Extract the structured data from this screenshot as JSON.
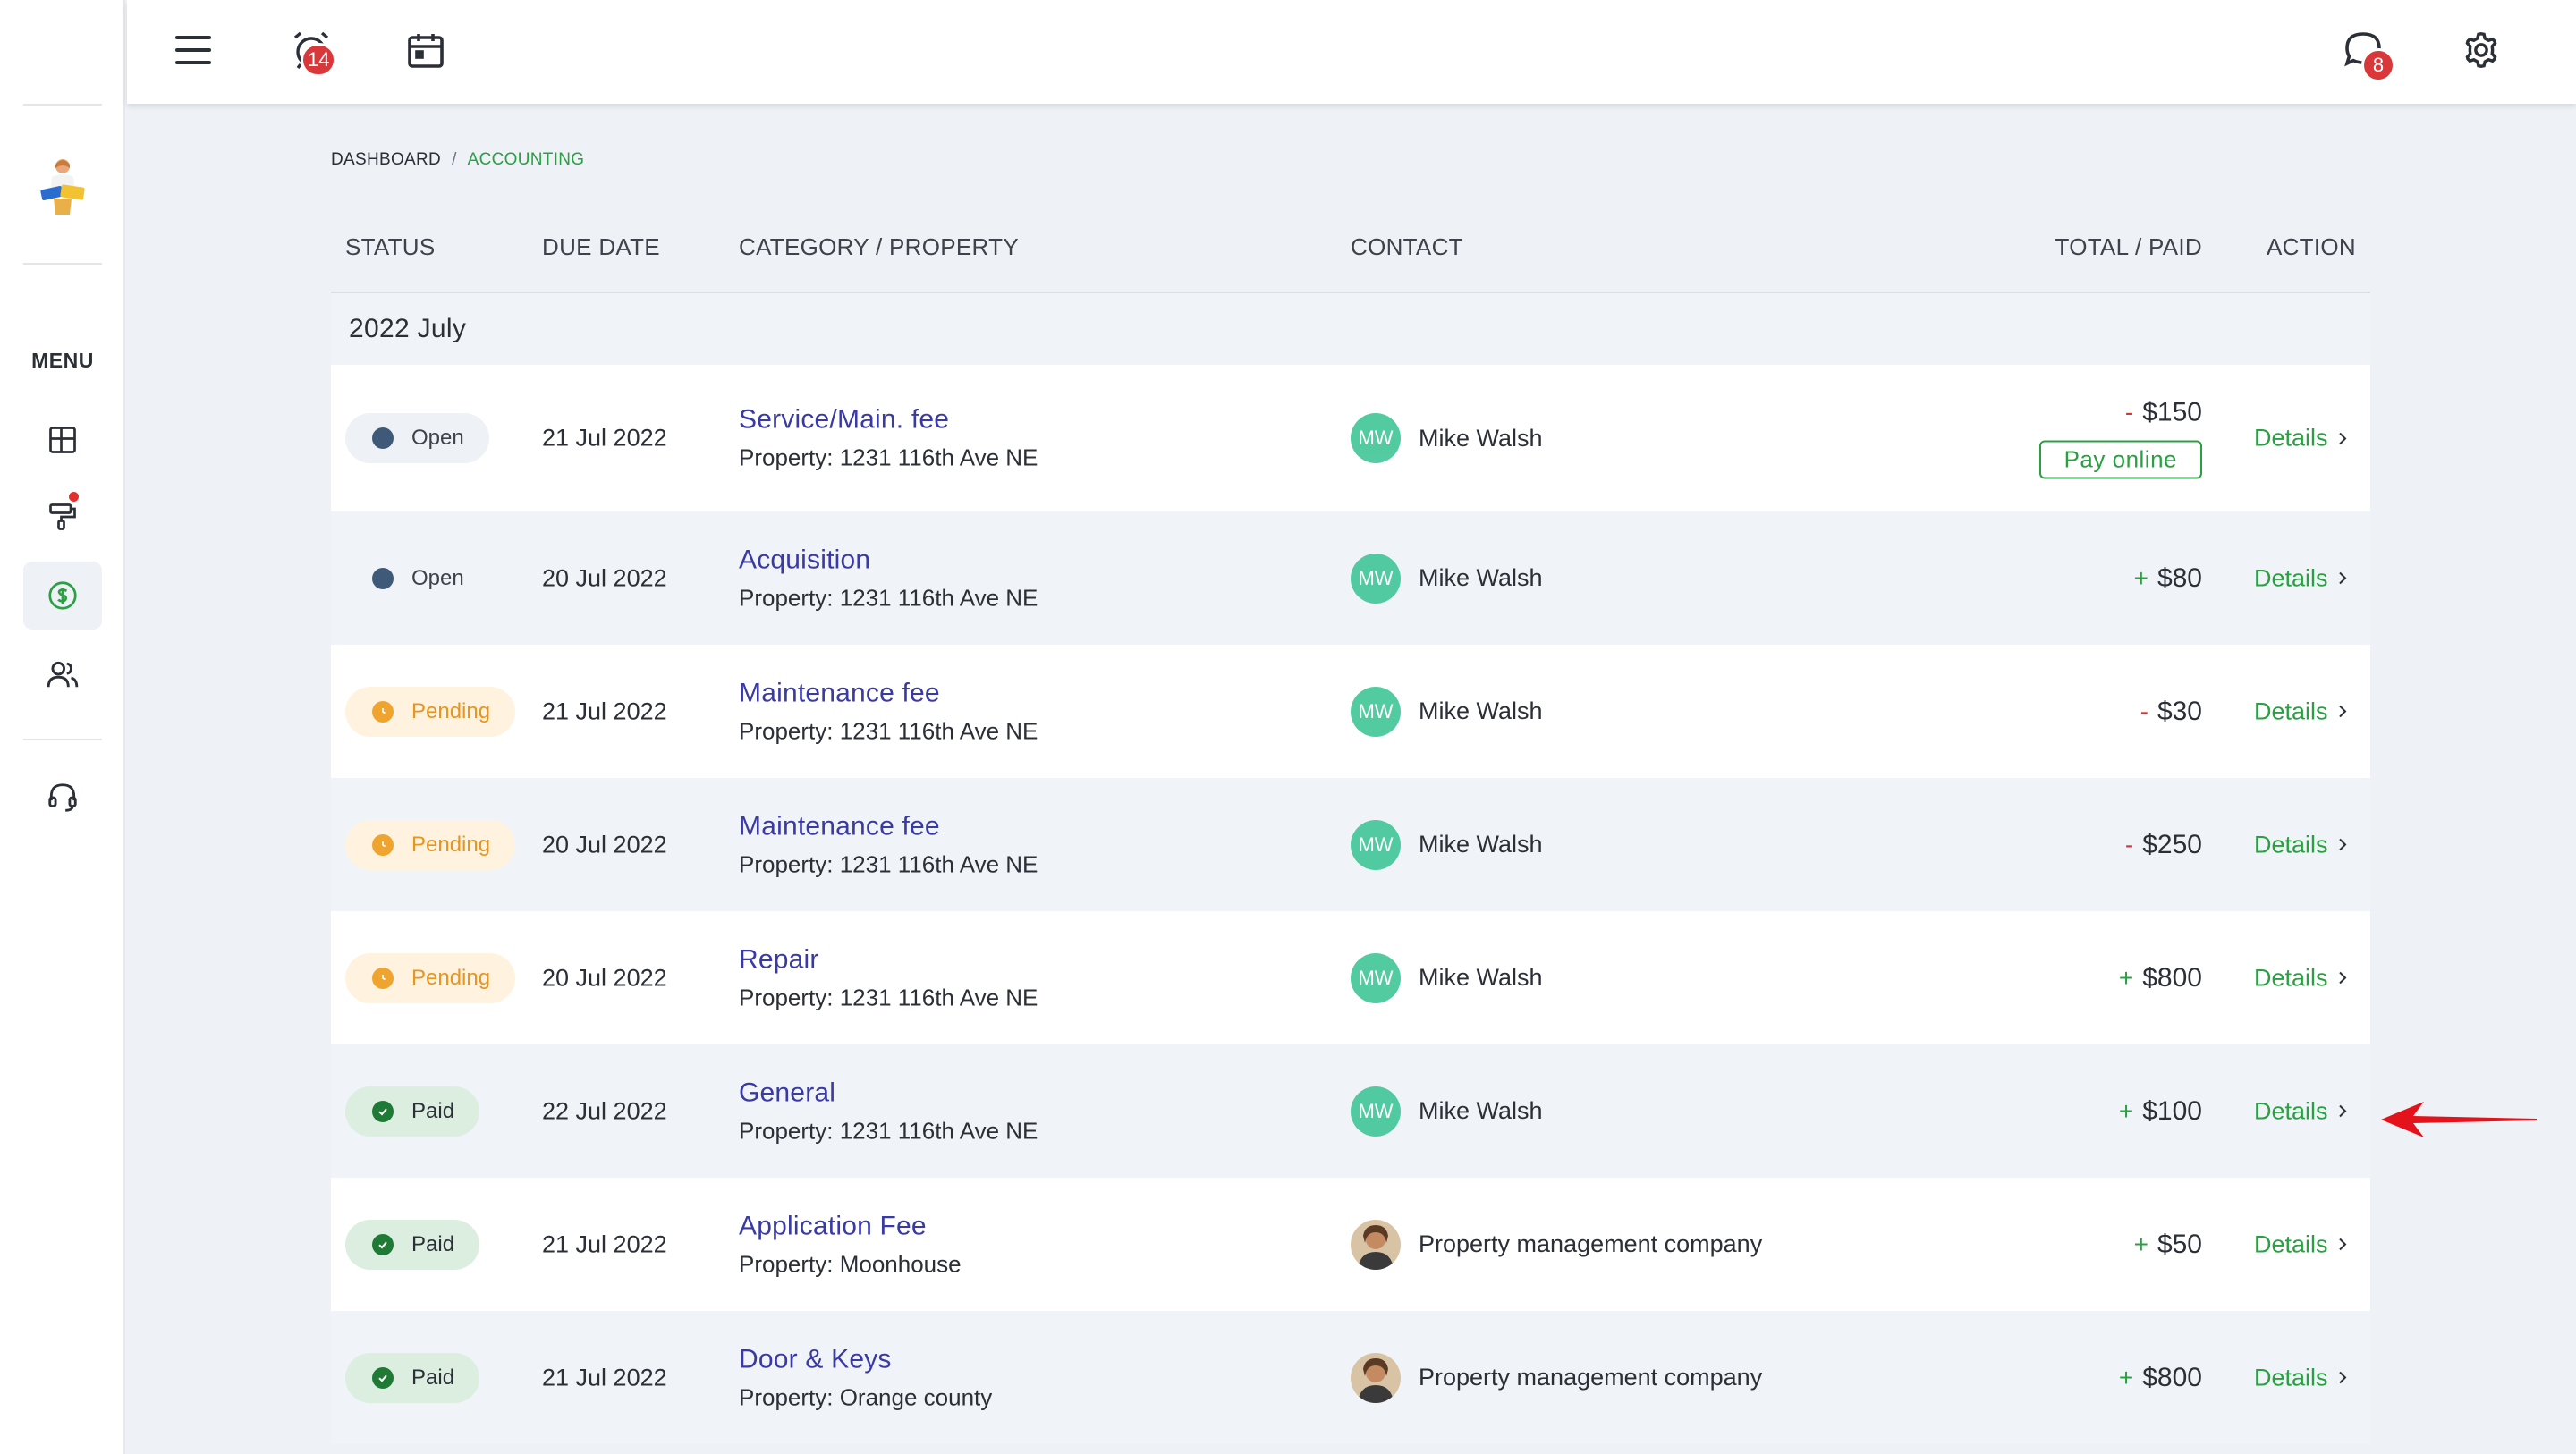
{
  "topbar": {
    "alarm_badge": "14",
    "chat_badge": "8"
  },
  "sidebar": {
    "menu_label": "MENU"
  },
  "breadcrumb": {
    "root": "DASHBOARD",
    "separator": "/",
    "current": "ACCOUNTING"
  },
  "table": {
    "headers": {
      "status": "STATUS",
      "due_date": "DUE DATE",
      "category": "CATEGORY / PROPERTY",
      "contact": "CONTACT",
      "total": "TOTAL / PAID",
      "action": "ACTION"
    },
    "group_label": "2022 July",
    "pay_online_label": "Pay online",
    "details_label": "Details",
    "rows": [
      {
        "status": "Open",
        "due": "21 Jul 2022",
        "title": "Service/Main. fee",
        "property": "Property: 1231 116th Ave NE",
        "contact_initials": "MW",
        "contact": "Mike Walsh",
        "sign": "-",
        "amount": "$150"
      },
      {
        "status": "Open",
        "due": "20 Jul 2022",
        "title": "Acquisition",
        "property": "Property: 1231 116th Ave NE",
        "contact_initials": "MW",
        "contact": "Mike Walsh",
        "sign": "+",
        "amount": "$80"
      },
      {
        "status": "Pending",
        "due": "21 Jul 2022",
        "title": "Maintenance fee",
        "property": "Property: 1231 116th Ave NE",
        "contact_initials": "MW",
        "contact": "Mike Walsh",
        "sign": "-",
        "amount": "$30"
      },
      {
        "status": "Pending",
        "due": "20 Jul 2022",
        "title": "Maintenance fee",
        "property": "Property: 1231 116th Ave NE",
        "contact_initials": "MW",
        "contact": "Mike Walsh",
        "sign": "-",
        "amount": "$250"
      },
      {
        "status": "Pending",
        "due": "20 Jul 2022",
        "title": "Repair",
        "property": "Property: 1231 116th Ave NE",
        "contact_initials": "MW",
        "contact": "Mike Walsh",
        "sign": "+",
        "amount": "$800"
      },
      {
        "status": "Paid",
        "due": "22 Jul 2022",
        "title": "General",
        "property": "Property: 1231 116th Ave NE",
        "contact_initials": "MW",
        "contact": "Mike Walsh",
        "sign": "+",
        "amount": "$100"
      },
      {
        "status": "Paid",
        "due": "21 Jul 2022",
        "title": "Application Fee",
        "property": "Property: Moonhouse",
        "contact_initials": "",
        "contact": "Property management company",
        "sign": "+",
        "amount": "$50"
      },
      {
        "status": "Paid",
        "due": "21 Jul 2022",
        "title": "Door & Keys",
        "property": "Property: Orange county",
        "contact_initials": "",
        "contact": "Property management company",
        "sign": "+",
        "amount": "$800"
      }
    ]
  },
  "colors": {
    "accent_green": "#2aa043",
    "link_blue": "#3a3aa5",
    "badge_red": "#d9383a",
    "pending_orange": "#e6951f",
    "annotation_arrow": "#e3121b"
  }
}
